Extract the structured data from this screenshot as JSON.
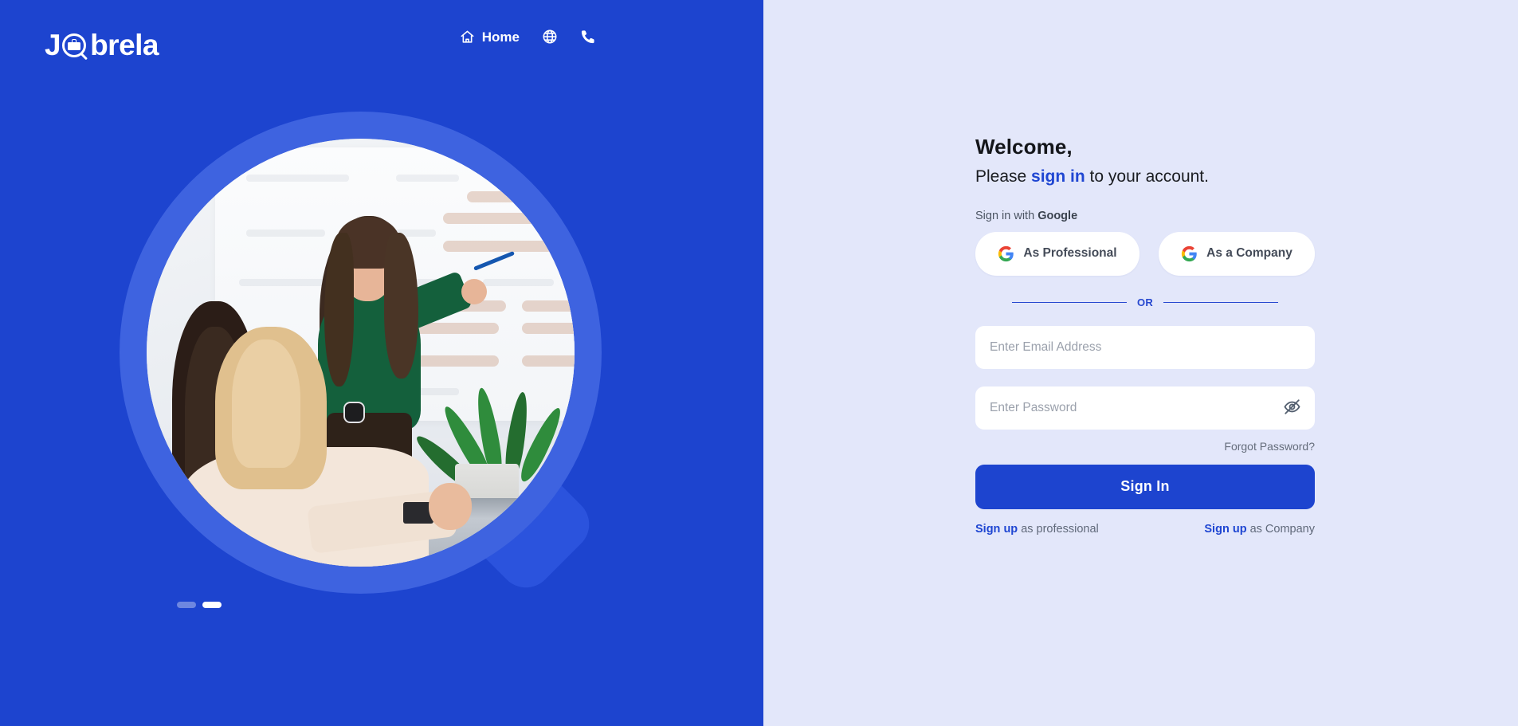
{
  "brand": {
    "name": "Jobrela",
    "letters_before": "J",
    "letters_after": "brela"
  },
  "nav": {
    "items": [
      {
        "label": "Home",
        "icon": "home-icon"
      },
      {
        "label": "",
        "icon": "globe-icon"
      },
      {
        "label": "",
        "icon": "phone-icon"
      }
    ]
  },
  "carousel": {
    "slides": [
      {
        "active": false
      },
      {
        "active": true
      }
    ]
  },
  "form": {
    "welcome": "Welcome,",
    "subtitle_before": "Please ",
    "subtitle_accent": "sign in",
    "subtitle_after": " to your account.",
    "google_label_before": "Sign in with ",
    "google_label_brand": "Google",
    "google_professional": "As Professional",
    "google_company": "As a Company",
    "or": "OR",
    "email_placeholder": "Enter Email Address",
    "email_value": "",
    "password_placeholder": "Enter Password",
    "password_value": "",
    "password_toggle_icon": "eye-off-icon",
    "forgot": "Forgot Password?",
    "submit": "Sign In",
    "signup_professional_link": "Sign up",
    "signup_professional_rest": " as professional",
    "signup_company_link": "Sign up",
    "signup_company_rest": " as Company"
  },
  "colors": {
    "brand_blue": "#1d44cf",
    "panel_bg": "#e3e7fa",
    "accent": "#1f46d2",
    "ring": "#3e63e0",
    "handle": "#2b53dd"
  }
}
